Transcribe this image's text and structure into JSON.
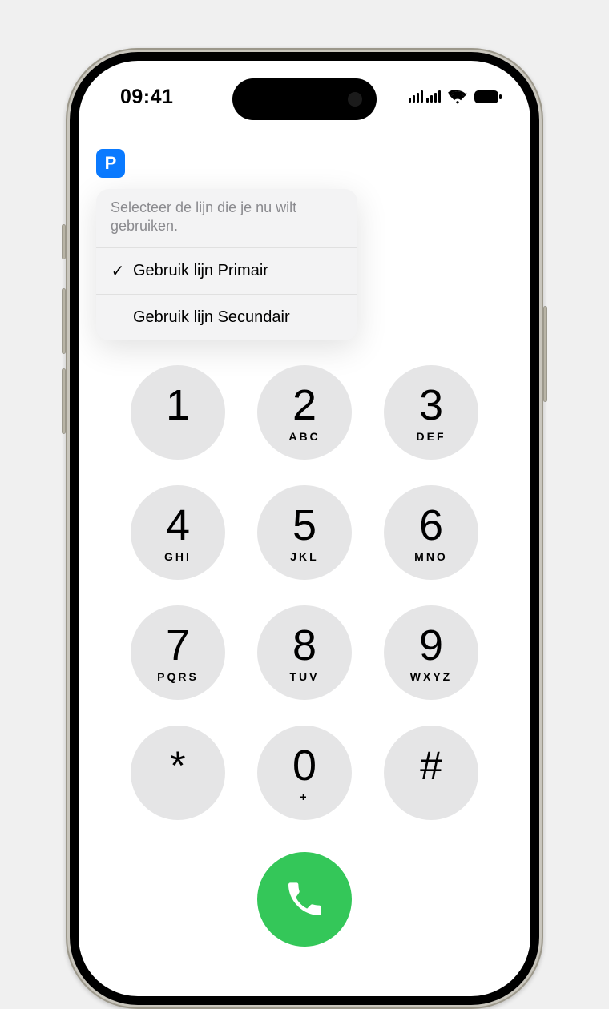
{
  "status": {
    "time": "09:41"
  },
  "nav": {
    "line_badge": "P"
  },
  "popover": {
    "header": "Selecteer de lijn die je nu wilt gebruiken.",
    "items": [
      {
        "label": "Gebruik lijn Primair",
        "selected": true
      },
      {
        "label": "Gebruik lijn Secundair",
        "selected": false
      }
    ]
  },
  "keypad": [
    [
      {
        "digit": "1",
        "letters": ""
      },
      {
        "digit": "2",
        "letters": "ABC"
      },
      {
        "digit": "3",
        "letters": "DEF"
      }
    ],
    [
      {
        "digit": "4",
        "letters": "GHI"
      },
      {
        "digit": "5",
        "letters": "JKL"
      },
      {
        "digit": "6",
        "letters": "MNO"
      }
    ],
    [
      {
        "digit": "7",
        "letters": "PQRS"
      },
      {
        "digit": "8",
        "letters": "TUV"
      },
      {
        "digit": "9",
        "letters": "WXYZ"
      }
    ],
    [
      {
        "digit": "*",
        "letters": ""
      },
      {
        "digit": "0",
        "letters": "+"
      },
      {
        "digit": "#",
        "letters": ""
      }
    ]
  ]
}
